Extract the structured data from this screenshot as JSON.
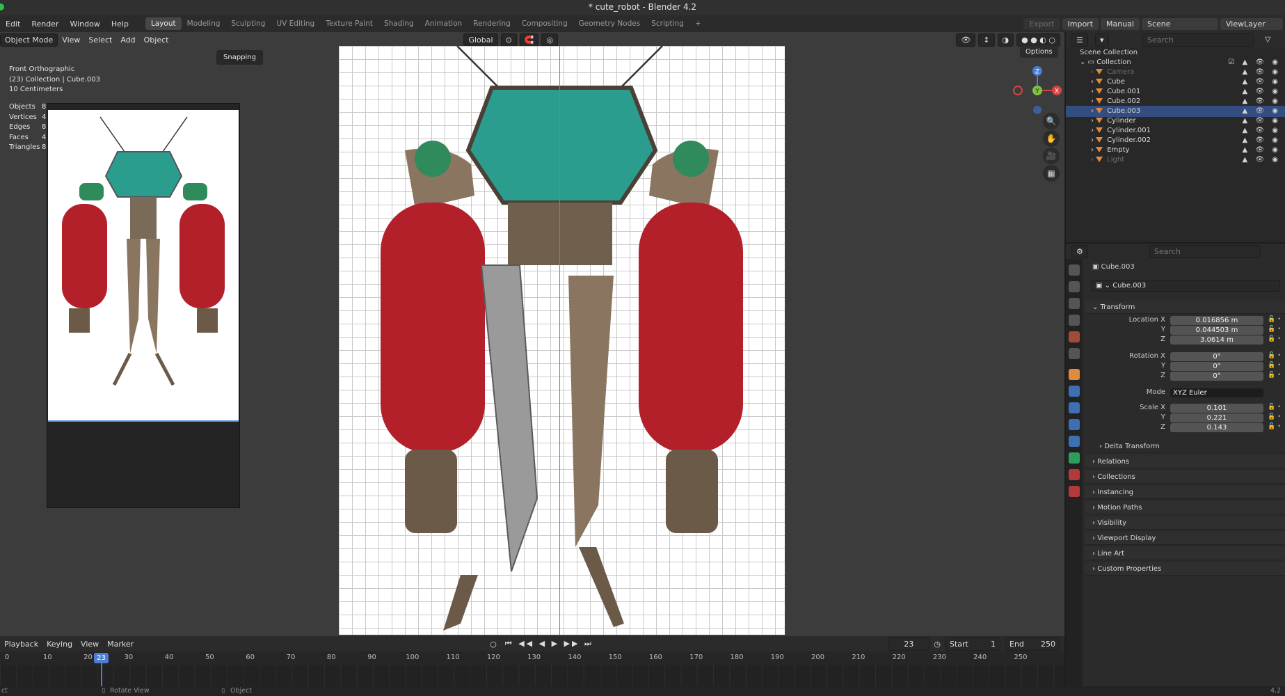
{
  "window": {
    "title": "* cute_robot - Blender 4.2"
  },
  "menu": [
    "Edit",
    "Render",
    "Window",
    "Help"
  ],
  "workspaces": [
    "Layout",
    "Modeling",
    "Sculpting",
    "UV Editing",
    "Texture Paint",
    "Shading",
    "Animation",
    "Rendering",
    "Compositing",
    "Geometry Nodes",
    "Scripting"
  ],
  "top_right": {
    "export": "Export",
    "import": "Import",
    "manual": "Manual",
    "scene": "Scene",
    "view_layer": "ViewLayer"
  },
  "viewport_header": {
    "mode": "Object Mode",
    "menus": [
      "View",
      "Select",
      "Add",
      "Object"
    ],
    "orientation": "Global",
    "options": "Options"
  },
  "viewport_info": {
    "view": "Front Orthographic",
    "collection": "(23) Collection | Cube.003",
    "scale": "10 Centimeters"
  },
  "stats": [
    {
      "k": "Objects",
      "v": "8"
    },
    {
      "k": "Vertices",
      "v": "4"
    },
    {
      "k": "Edges",
      "v": "8"
    },
    {
      "k": "Faces",
      "v": "4"
    },
    {
      "k": "Triangles",
      "v": "8"
    }
  ],
  "tooltip": "Snapping",
  "gizmo_axes": {
    "z": "Z",
    "y": "Y",
    "x": "X"
  },
  "timeline": {
    "menus": [
      "Playback",
      "Keying",
      "View",
      "Marker"
    ],
    "current_frame": "23",
    "start_label": "Start",
    "start": "1",
    "end_label": "End",
    "end": "250",
    "ticks": [
      "0",
      "10",
      "20",
      "30",
      "40",
      "50",
      "60",
      "70",
      "80",
      "90",
      "100",
      "110",
      "120",
      "130",
      "140",
      "150",
      "160",
      "170",
      "180",
      "190",
      "200",
      "210",
      "220",
      "230",
      "240",
      "250"
    ]
  },
  "statusbar": {
    "left": "ct",
    "rotate": "Rotate View",
    "object": "Object",
    "version": "4.2"
  },
  "outliner": {
    "search_placeholder": "Search",
    "root": "Scene Collection",
    "collection": "Collection",
    "items": [
      {
        "name": "Camera",
        "dim": true
      },
      {
        "name": "Cube",
        "dim": false
      },
      {
        "name": "Cube.001",
        "dim": false
      },
      {
        "name": "Cube.002",
        "dim": false
      },
      {
        "name": "Cube.003",
        "dim": false,
        "selected": true
      },
      {
        "name": "Cylinder",
        "dim": false
      },
      {
        "name": "Cylinder.001",
        "dim": false
      },
      {
        "name": "Cylinder.002",
        "dim": false
      },
      {
        "name": "Empty",
        "dim": false
      },
      {
        "name": "Light",
        "dim": true
      }
    ]
  },
  "properties": {
    "search_placeholder": "Search",
    "object_name": "Cube.003",
    "datablock": "Cube.003",
    "transform_label": "Transform",
    "location_label": "Location X",
    "location": [
      "0.016856 m",
      "0.044503 m",
      "3.0614 m"
    ],
    "rotation_label": "Rotation X",
    "rotation": [
      "0°",
      "0°",
      "0°"
    ],
    "mode_label": "Mode",
    "mode": "XYZ Euler",
    "scale_label": "Scale X",
    "scale": [
      "0.101",
      "0.221",
      "0.143"
    ],
    "axis_y": "Y",
    "axis_z": "Z",
    "sections": [
      "Delta Transform",
      "Relations",
      "Collections",
      "Instancing",
      "Motion Paths",
      "Visibility",
      "Viewport Display",
      "Line Art",
      "Custom Properties"
    ]
  },
  "colors": {
    "accent": "#4a7fd4",
    "selection": "#334d80",
    "object_icon": "#e08a3c",
    "robot_red": "#b3202a",
    "robot_glass": "#2a9d8f",
    "robot_metal": "#8a7560"
  }
}
